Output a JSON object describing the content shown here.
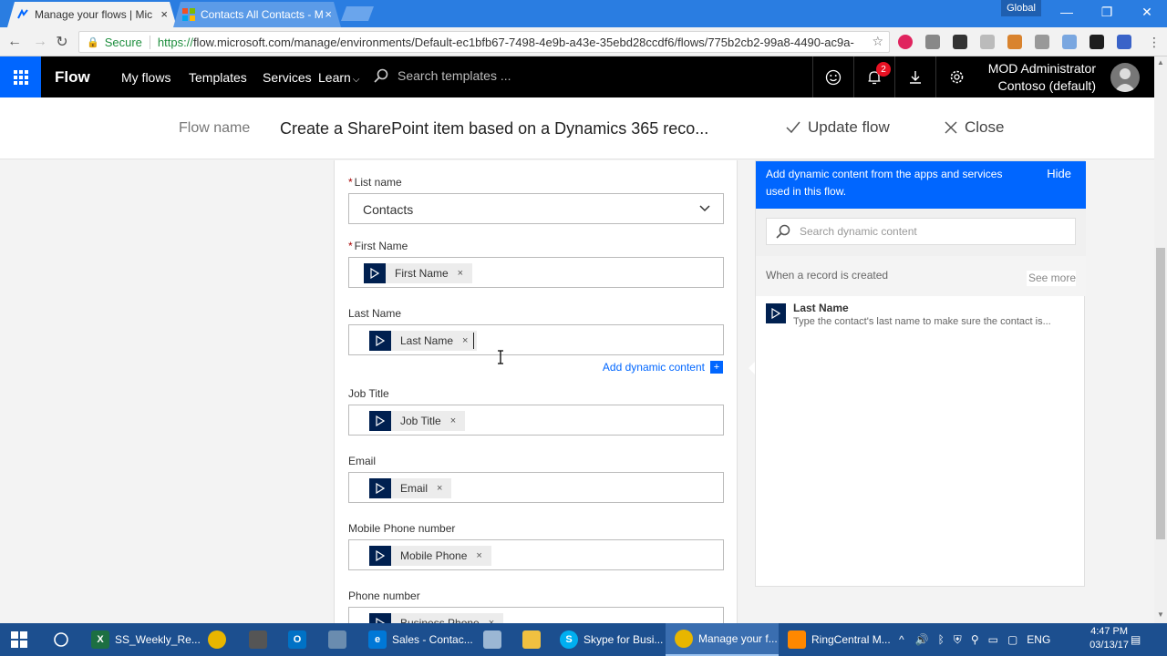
{
  "browser": {
    "tabs": [
      {
        "title": "Manage your flows | Mic",
        "active": true
      },
      {
        "title": "Contacts All Contacts - M",
        "active": false
      }
    ],
    "profile": "Global",
    "secure_label": "Secure",
    "url_scheme": "https://",
    "url_rest": "flow.microsoft.com/manage/environments/Default-ec1bfb67-7498-4e9b-a43e-35ebd28ccdf6/flows/775b2cb2-99a8-4490-ac9a-"
  },
  "header": {
    "brand": "Flow",
    "nav": [
      "My flows",
      "Templates",
      "Services",
      "Learn"
    ],
    "search_placeholder": "Search templates ...",
    "notification_count": "2",
    "user_name": "MOD Administrator",
    "user_org": "Contoso (default)"
  },
  "flowbar": {
    "label": "Flow name",
    "name": "Create a SharePoint item based on a Dynamics 365 reco...",
    "update": "Update flow",
    "close": "Close"
  },
  "form": {
    "list_label": "List name",
    "list_value": "Contacts",
    "fields": [
      {
        "label": "First Name",
        "required": true,
        "token": "First Name"
      },
      {
        "label": "Last Name",
        "required": false,
        "token": "Last Name"
      },
      {
        "label": "Job Title",
        "required": false,
        "token": "Job Title"
      },
      {
        "label": "Email",
        "required": false,
        "token": "Email"
      },
      {
        "label": "Mobile Phone number",
        "required": false,
        "token": "Mobile Phone"
      },
      {
        "label": "Phone number",
        "required": false,
        "token": "Business Phone"
      }
    ],
    "add_dynamic": "Add dynamic content",
    "req_mark": "*",
    "token_x": "×"
  },
  "panel": {
    "message": "Add dynamic content from the apps and services used in this flow.",
    "hide": "Hide",
    "search_placeholder": "Search dynamic content",
    "section_title": "When a record is created",
    "see_more": "See more",
    "item_title": "Last Name",
    "item_desc": "Type the contact's last name to make sure the contact is..."
  },
  "taskbar": {
    "items": [
      "SS_Weekly_Re...",
      "Sales - Contac...",
      "Skype for Busi...",
      "Manage your f...",
      "RingCentral M..."
    ],
    "lang": "ENG",
    "time": "4:47 PM",
    "date": "03/13/17"
  }
}
